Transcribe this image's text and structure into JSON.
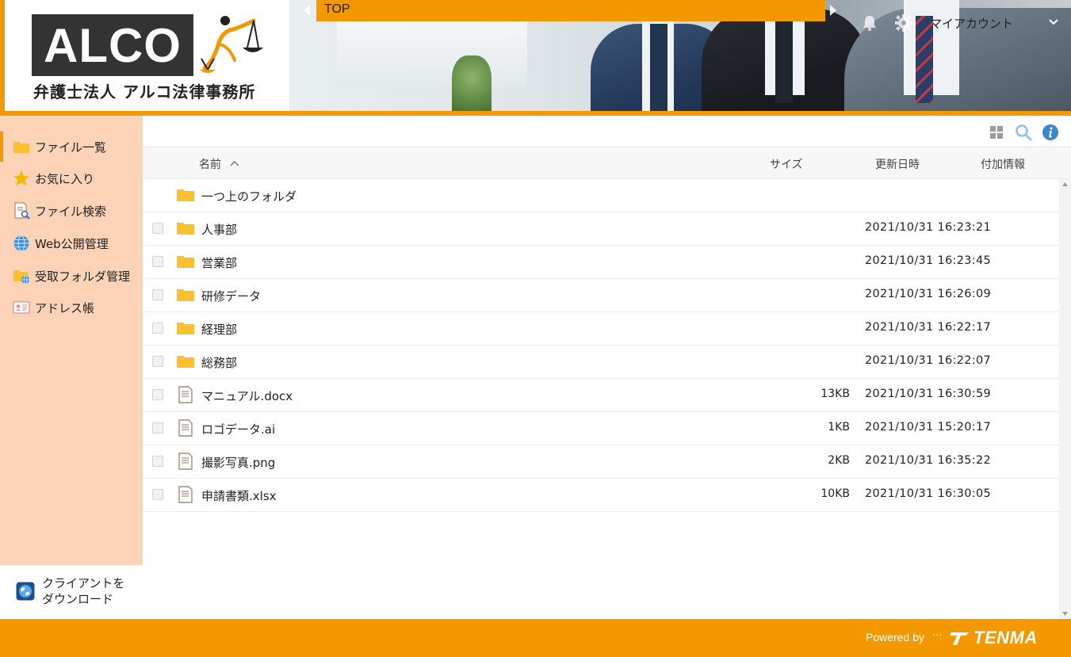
{
  "brand": {
    "logo_text": "ALCO",
    "logo_subtitle": "弁護士法人 アルコ法律事務所",
    "accent_color": "#f39800",
    "sidebar_color": "#fdd3b8"
  },
  "header": {
    "breadcrumb": "TOP",
    "account_label": "マイアカウント",
    "icons": [
      "bell-icon",
      "gear-icon",
      "chevron-down-icon"
    ]
  },
  "sidebar": {
    "items": [
      {
        "label": "ファイル一覧",
        "icon": "folder-icon",
        "active": true
      },
      {
        "label": "お気に入り",
        "icon": "star-icon",
        "active": false
      },
      {
        "label": "ファイル検索",
        "icon": "file-search-icon",
        "active": false
      },
      {
        "label": "Web公開管理",
        "icon": "globe-icon",
        "active": false
      },
      {
        "label": "受取フォルダ管理",
        "icon": "folder-globe-icon",
        "active": false
      },
      {
        "label": "アドレス帳",
        "icon": "address-card-icon",
        "active": false
      }
    ],
    "client_download": {
      "line1": "クライアントを",
      "line2": "ダウンロード",
      "icon": "client-globe-icon"
    }
  },
  "toolbar": {
    "icons": [
      "grid-view-icon",
      "search-icon",
      "info-icon"
    ]
  },
  "table": {
    "columns": {
      "name": "名前",
      "size": "サイズ",
      "updated": "更新日時",
      "extra": "付加情報"
    },
    "sort": "name-ascending",
    "parent_folder": "一つ上のフォルダ",
    "rows": [
      {
        "name": "人事部",
        "type": "folder",
        "size": "",
        "updated": "2021/10/31 16:23:21"
      },
      {
        "name": "営業部",
        "type": "folder",
        "size": "",
        "updated": "2021/10/31 16:23:45"
      },
      {
        "name": "研修データ",
        "type": "folder",
        "size": "",
        "updated": "2021/10/31 16:26:09"
      },
      {
        "name": "経理部",
        "type": "folder",
        "size": "",
        "updated": "2021/10/31 16:22:17"
      },
      {
        "name": "総務部",
        "type": "folder",
        "size": "",
        "updated": "2021/10/31 16:22:07"
      },
      {
        "name": "マニュアル.docx",
        "type": "file",
        "size": "13KB",
        "updated": "2021/10/31 16:30:59"
      },
      {
        "name": "ロゴデータ.ai",
        "type": "file",
        "size": "1KB",
        "updated": "2021/10/31 15:20:17"
      },
      {
        "name": "撮影写真.png",
        "type": "file",
        "size": "2KB",
        "updated": "2021/10/31 16:35:22"
      },
      {
        "name": "申請書類.xlsx",
        "type": "file",
        "size": "10KB",
        "updated": "2021/10/31 16:30:05"
      }
    ]
  },
  "footer": {
    "powered_by": "Powered by",
    "dots": "···",
    "brand": "TENMA"
  }
}
